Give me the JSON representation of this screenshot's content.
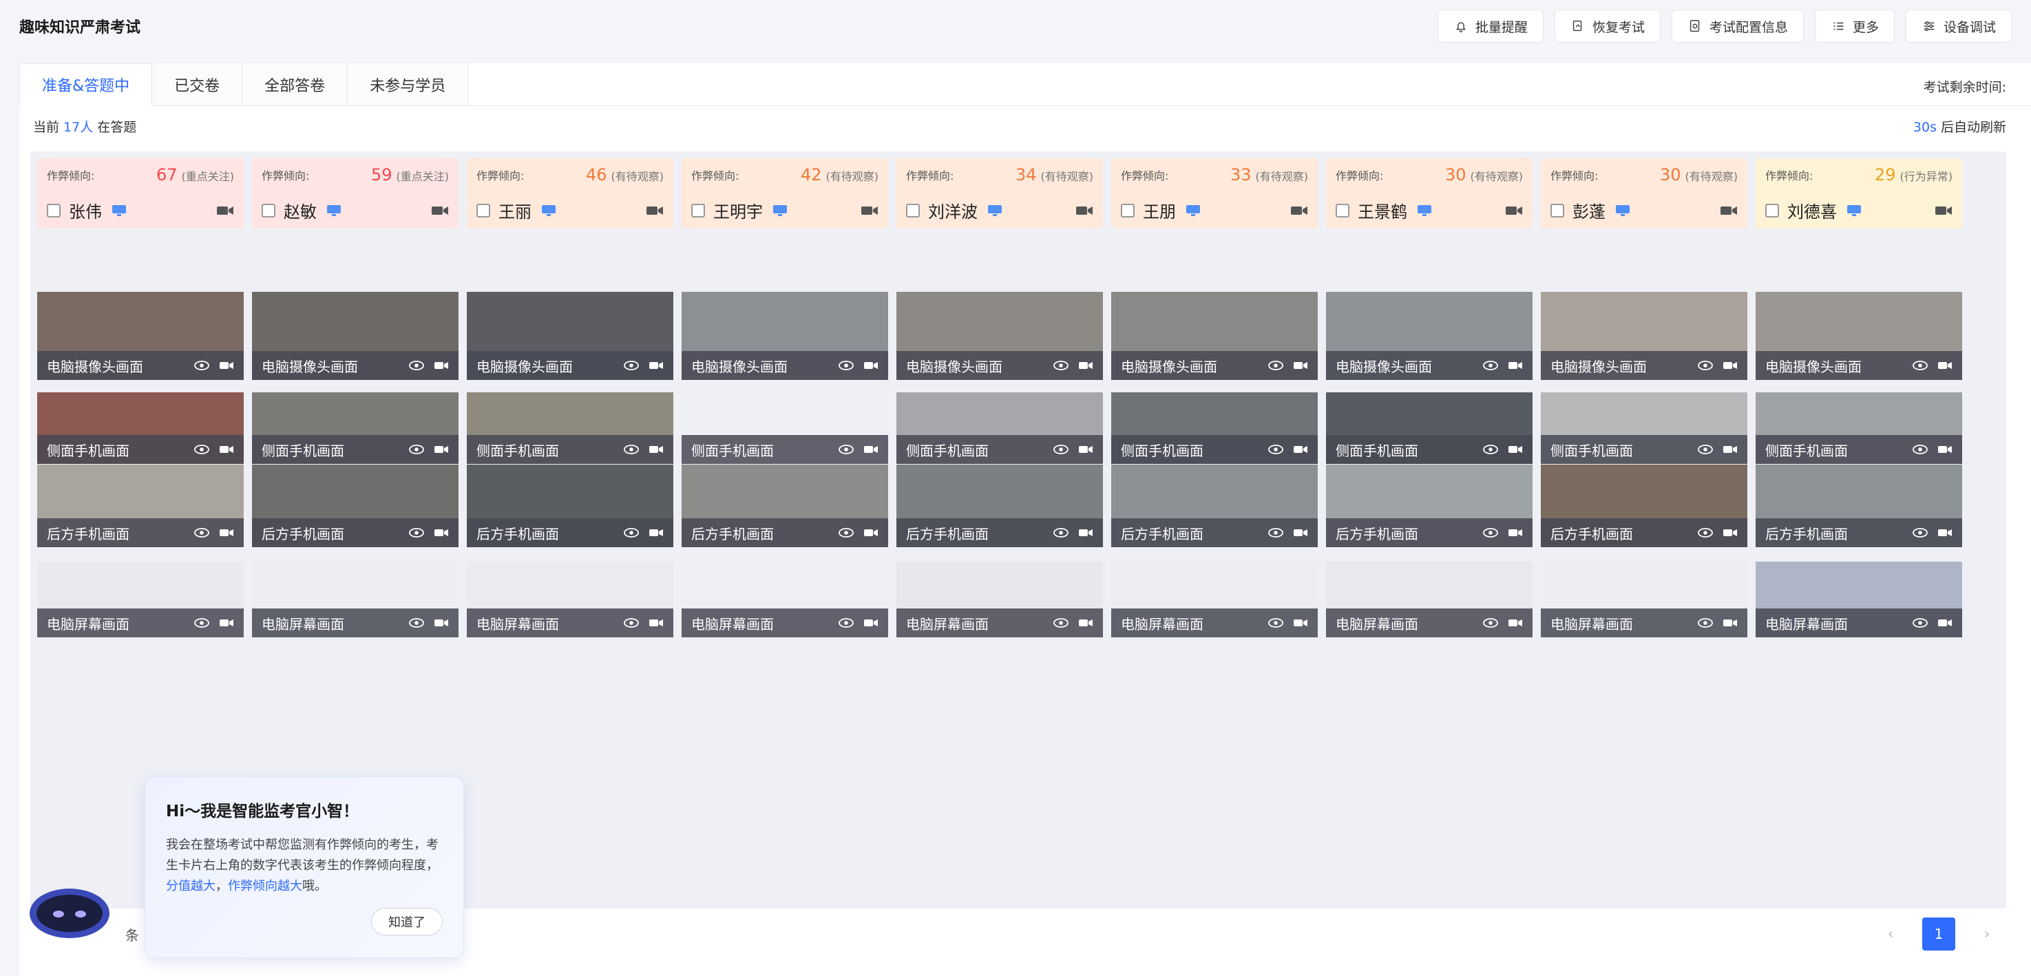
{
  "app": {
    "title": "趣味知识严肃考试"
  },
  "toolbar": [
    {
      "name": "batch-remind-button",
      "icon": "bell-icon",
      "label": "批量提醒"
    },
    {
      "name": "resume-exam-button",
      "icon": "restore-icon",
      "label": "恢复考试"
    },
    {
      "name": "exam-config-button",
      "icon": "doc-settings-icon",
      "label": "考试配置信息"
    },
    {
      "name": "more-button",
      "icon": "list-icon",
      "label": "更多"
    },
    {
      "name": "device-debug-button",
      "icon": "sliders-icon",
      "label": "设备调试"
    }
  ],
  "tabs": [
    {
      "label": "准备&答题中",
      "active": true
    },
    {
      "label": "已交卷",
      "active": false
    },
    {
      "label": "全部答卷",
      "active": false
    },
    {
      "label": "未参与学员",
      "active": false
    }
  ],
  "remain_label": "考试剩余时间:",
  "status": {
    "prefix": "当前",
    "count": "17人",
    "suffix": "在答题"
  },
  "refresh": {
    "seconds": "30s",
    "text": "后自动刷新"
  },
  "cheat_label": "作弊倾向:",
  "feed_labels": {
    "front": "电脑摄像头画面",
    "side": "侧面手机画面",
    "back": "后方手机画面",
    "screen": "电脑屏幕画面"
  },
  "students": [
    {
      "name": "张伟",
      "score": "67",
      "level": "(重点关注)",
      "color": "#f5474d",
      "bg": "#ffe4e4"
    },
    {
      "name": "赵敏",
      "score": "59",
      "level": "(重点关注)",
      "color": "#f5474d",
      "bg": "#ffe4e4"
    },
    {
      "name": "王丽",
      "score": "46",
      "level": "(有待观察)",
      "color": "#f07a3a",
      "bg": "#ffe9db"
    },
    {
      "name": "王明宇",
      "score": "42",
      "level": "(有待观察)",
      "color": "#f07a3a",
      "bg": "#ffe9db"
    },
    {
      "name": "刘洋波",
      "score": "34",
      "level": "(有待观察)",
      "color": "#f07a3a",
      "bg": "#ffe9db"
    },
    {
      "name": "王朋",
      "score": "33",
      "level": "(有待观察)",
      "color": "#f07a3a",
      "bg": "#ffe9db"
    },
    {
      "name": "王景鹤",
      "score": "30",
      "level": "(有待观察)",
      "color": "#f07a3a",
      "bg": "#ffe9db"
    },
    {
      "name": "彭蓬",
      "score": "30",
      "level": "(有待观察)",
      "color": "#f07a3a",
      "bg": "#ffe9db"
    },
    {
      "name": "刘德喜",
      "score": "29",
      "level": "(行为异常)",
      "color": "#e8a21a",
      "bg": "#fff3d6"
    }
  ],
  "assistant": {
    "heading": "Hi～我是智能监考官小智！",
    "text1": "我会在整场考试中帮您监测有作弊倾向的考生，考生卡片右上角的数字代表该考生的作弊倾向程度，",
    "hl1": "分值越大",
    "sep": "，",
    "hl2": "作弊倾向越大",
    "text2": "哦。",
    "ok": "知道了"
  },
  "pagination": {
    "total_suffix": "条",
    "current": "1"
  },
  "colors": {
    "accent": "#2f6bff"
  }
}
